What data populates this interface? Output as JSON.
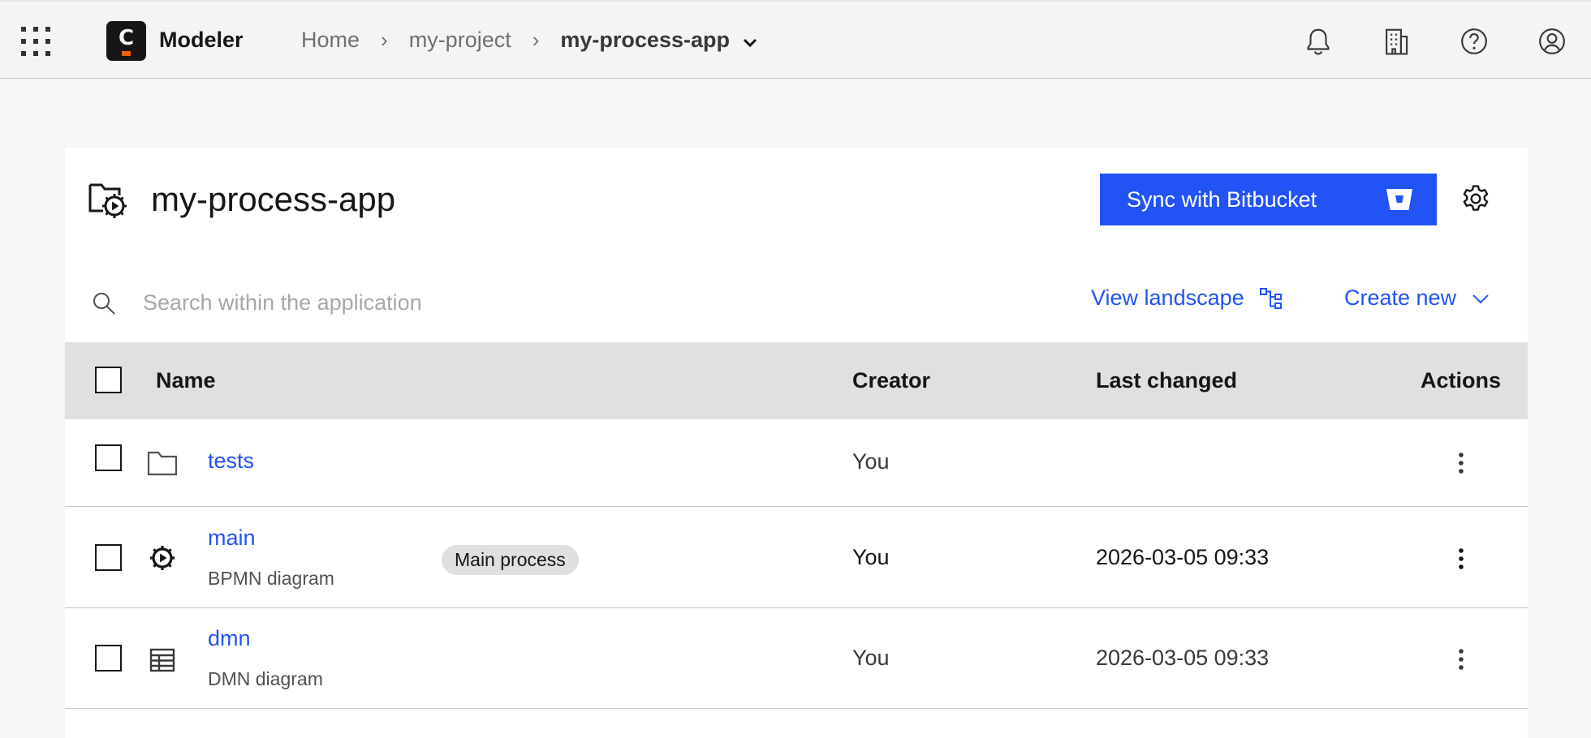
{
  "header": {
    "app_name": "Modeler",
    "breadcrumb": [
      {
        "label": "Home"
      },
      {
        "label": "my-project"
      },
      {
        "label": "my-process-app"
      }
    ],
    "separator": "›",
    "icons": [
      "notification-icon",
      "organization-icon",
      "help-icon",
      "user-avatar-icon"
    ]
  },
  "project": {
    "title": "my-process-app",
    "sync_label": "Sync with Bitbucket"
  },
  "toolbar": {
    "search_placeholder": "Search within the application",
    "view_landscape": "View landscape",
    "create_new": "Create new"
  },
  "table": {
    "columns": {
      "name": "Name",
      "creator": "Creator",
      "last_changed": "Last changed",
      "actions": "Actions"
    },
    "rows": [
      {
        "name": "tests",
        "type": "",
        "tag": "",
        "creator": "You",
        "last_changed": "",
        "icon": "folder-icon"
      },
      {
        "name": "main",
        "type": "BPMN diagram",
        "tag": "Main process",
        "creator": "You",
        "last_changed": "2026-03-05 09:33",
        "icon": "bpmn-gear-icon"
      },
      {
        "name": "dmn",
        "type": "DMN diagram",
        "tag": "",
        "creator": "You",
        "last_changed": "2026-03-05 09:33",
        "icon": "dmn-table-icon"
      }
    ]
  },
  "colors": {
    "primary": "#2253f5",
    "header_bg": "#f4f4f4",
    "table_header_bg": "#e0e0e0",
    "logo_accent": "#fc5d0d"
  }
}
